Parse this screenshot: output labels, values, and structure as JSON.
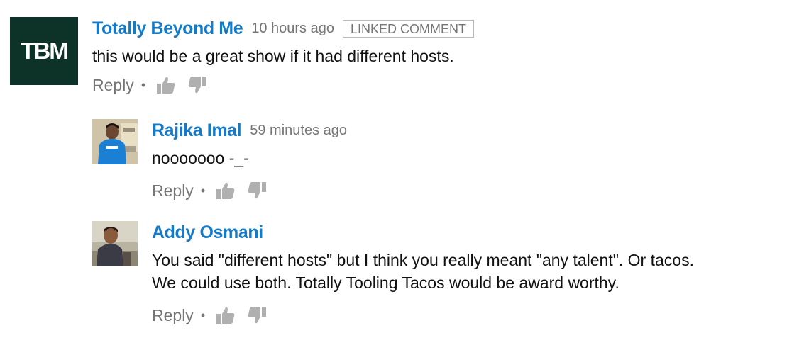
{
  "comments": [
    {
      "author": "Totally Beyond Me",
      "time": "10 hours ago",
      "badge": "LINKED COMMENT",
      "avatar_text": "TBM",
      "avatar_color": "#0d3328",
      "lines": [
        "this would be a great show if it had different hosts."
      ],
      "reply_label": "Reply",
      "separator": "•"
    },
    {
      "author": "Rajika Imal",
      "time": "59 minutes ago",
      "lines": [
        "nooooooo -_-"
      ],
      "reply_label": "Reply",
      "separator": "•"
    },
    {
      "author": "Addy Osmani",
      "lines": [
        "You said \"different hosts\" but I think you really meant \"any talent\". Or tacos.",
        "We could use both. Totally Tooling Tacos would be award worthy."
      ],
      "reply_label": "Reply",
      "separator": "•"
    }
  ],
  "colors": {
    "author_link": "#167ac6",
    "meta_gray": "#767676",
    "icon_gray": "#b0b0b0"
  },
  "icons": {
    "like": "thumbs-up-icon",
    "dislike": "thumbs-down-icon"
  }
}
